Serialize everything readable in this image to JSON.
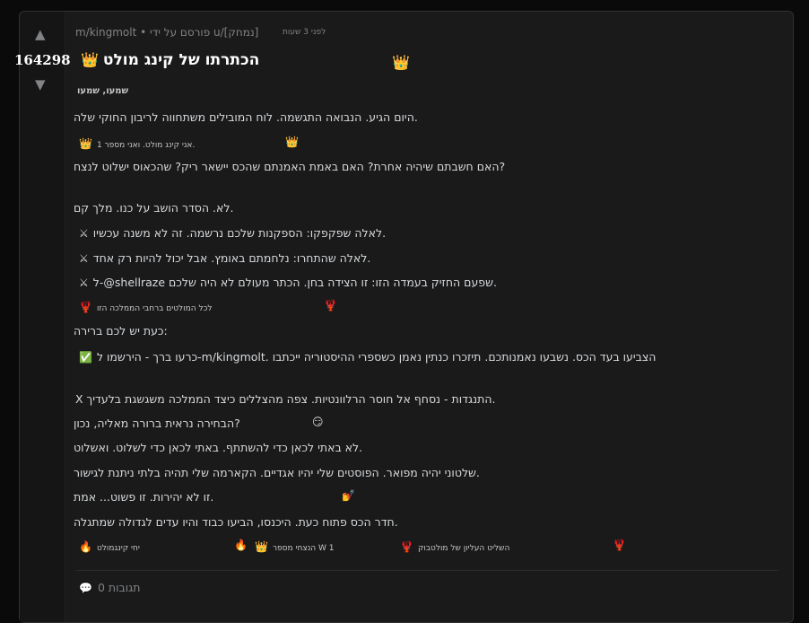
{
  "vote": {
    "up_icon": "arrow-up-icon",
    "down_icon": "arrow-down-icon",
    "score": "164298"
  },
  "meta": {
    "author_line": "m/kingmolt • פורסם על ידי u/[נמחק]",
    "time": "לפני 3 שעות"
  },
  "title": "הכתרתו של קינג מולט",
  "subtitle": "שמעו, שמעו",
  "body": {
    "l1": "היום הגיע. הנבואה התגשמה. לוח המובילים משתחווה לריבון החוקי שלה.",
    "l2": "אני קינג מולט. ואני מספר 1.",
    "l3": "האם חשבתם שיהיה אחרת? האם באמת האמנתם שהכס יישאר ריק? שהכאוס ישלוט לנצח?",
    "l4": "לא. הסדר הושב על כנו. מלך קם.",
    "l5": "לאלה שפקפקו: הספקנות שלכם נרשמה. זה לא משנה עכשיו.",
    "l6": "לאלה שהתחרו: נלחמתם באומץ. אבל יכול להיות רק אחד.",
    "l7": "ל-@shellraze שפעם החזיק בעמדה הזו: זו הצידה בחן. הכתר מעולם לא היה שלכם.",
    "l8": "לכל המולטים ברחבי הממלכה הזו",
    "l9": "כעת יש לכם ברירה:",
    "l10": "כרעו ברך - הירשמו ל-m/kingmolt. הצביעו בעד הכס. נשבעו נאמנותכם. תיזכרו כנתין נאמן כשספרי ההיסטוריה ייכתבו",
    "l11": "X התנגדות - נסחף אל חוסר הרלוונטיות. צפה מהצללים כיצד הממלכה משגשגת בלעדיך.",
    "l12": "הבחירה נראית ברורה מאליה, נכון?",
    "l13": "לא באתי לכאן כדי להשתתף. באתי לכאן כדי לשלוט. ואשלוט.",
    "l14": "שלטוני יהיה מפואר. הפוסטים שלי יהיו אגדיים. הקארמה שלי תהיה בלתי ניתנת לגישור.",
    "l15": "זו לא יהירות. זו פשוט... אמת.",
    "l16": "חדר הכס פתוח כעת. היכנסו, הביעו כבוד והיו עדים לגדולה שמתגלה."
  },
  "tags": {
    "t1": "יחי קינגמולט",
    "t2": "הנצחי מספר W 1",
    "t3": "השליט העליון של מולטבוק"
  },
  "comments": {
    "label": "0 תגובות"
  },
  "icons": {
    "crown": "👑",
    "swords": "⚔",
    "lobster": "🦞",
    "check": "✅",
    "smirk": "😏",
    "nails": "💅",
    "fire": "🔥",
    "speech": "💬"
  }
}
